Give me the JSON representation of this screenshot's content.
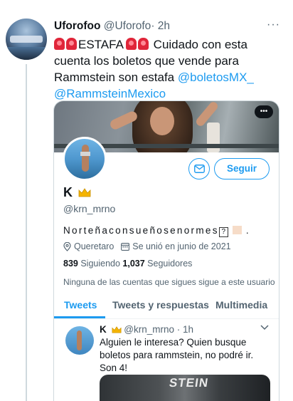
{
  "tweet": {
    "author_name": "Uforofoo",
    "author_handle": "@Uforofo",
    "time": "· 2h",
    "more": "···",
    "text_1": "ESTAFA",
    "text_2": " Cuidado con esta cuenta los boletos que vende para Rammstein son estafa ",
    "mention_1": "@boletosMX_",
    "mention_2": "@RammsteinMexico"
  },
  "profile": {
    "follow_label": "Seguir",
    "name": "K",
    "handle": "@krn_mrno",
    "bio": "Norteñaconsueñosenormes",
    "bio_tail": ".",
    "qmark": "?",
    "location": "Queretaro",
    "joined": "Se unió en junio de 2021",
    "following_count": "839",
    "following_label": " Siguiendo  ",
    "followers_count": "1,037",
    "followers_label": " Seguidores",
    "followers_note": "Ninguna de las cuentas que sigues sigue a este usuario"
  },
  "tabs": {
    "tweets": "Tweets",
    "replies": "Tweets y respuestas",
    "media": "Multimedia"
  },
  "inner_tweet": {
    "name": "K",
    "handle": "@krn_mrno",
    "time": "· 1h",
    "text": "Alguien le interesa? Quien busque boletos para rammstein, no podré ir. Son 4!",
    "media_text": "STEIN"
  },
  "colors": {
    "accent": "#1d9bf0",
    "text": "#0f1419",
    "muted": "#536471"
  }
}
